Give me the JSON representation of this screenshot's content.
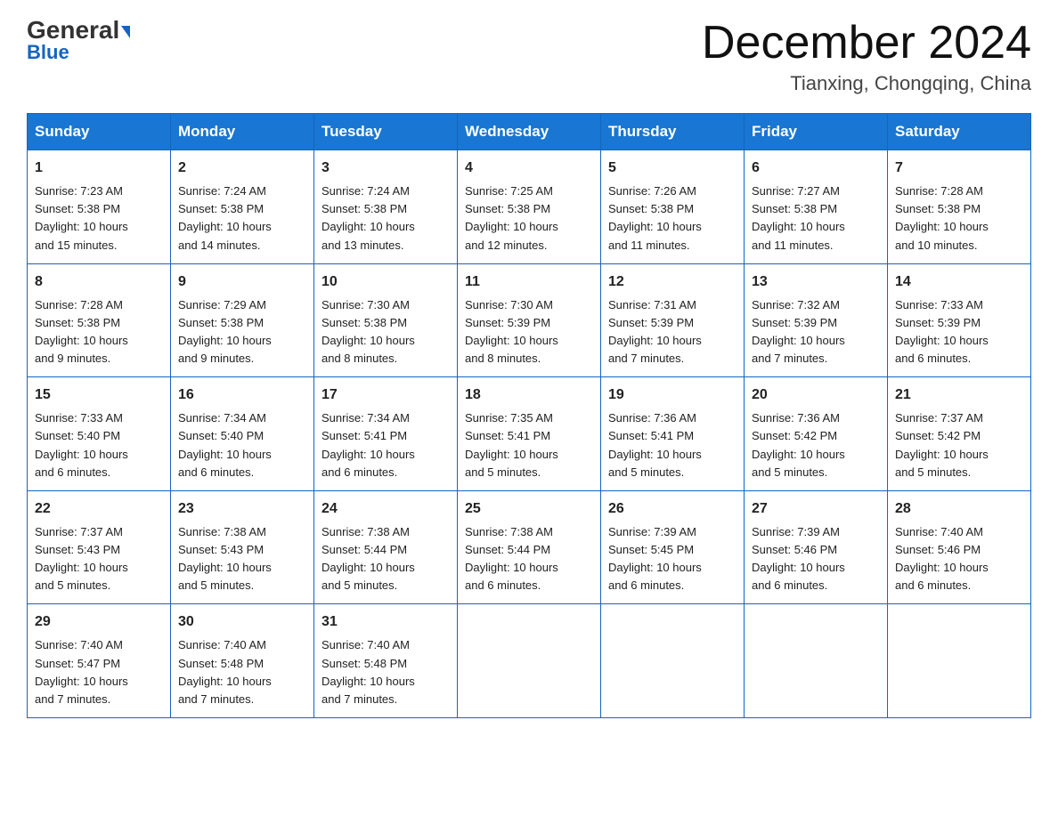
{
  "logo": {
    "general": "General",
    "blue": "Blue",
    "triangle": "▶"
  },
  "header": {
    "month_year": "December 2024",
    "location": "Tianxing, Chongqing, China"
  },
  "days_of_week": [
    "Sunday",
    "Monday",
    "Tuesday",
    "Wednesday",
    "Thursday",
    "Friday",
    "Saturday"
  ],
  "weeks": [
    [
      {
        "day": "1",
        "sunrise": "7:23 AM",
        "sunset": "5:38 PM",
        "daylight": "10 hours and 15 minutes."
      },
      {
        "day": "2",
        "sunrise": "7:24 AM",
        "sunset": "5:38 PM",
        "daylight": "10 hours and 14 minutes."
      },
      {
        "day": "3",
        "sunrise": "7:24 AM",
        "sunset": "5:38 PM",
        "daylight": "10 hours and 13 minutes."
      },
      {
        "day": "4",
        "sunrise": "7:25 AM",
        "sunset": "5:38 PM",
        "daylight": "10 hours and 12 minutes."
      },
      {
        "day": "5",
        "sunrise": "7:26 AM",
        "sunset": "5:38 PM",
        "daylight": "10 hours and 11 minutes."
      },
      {
        "day": "6",
        "sunrise": "7:27 AM",
        "sunset": "5:38 PM",
        "daylight": "10 hours and 11 minutes."
      },
      {
        "day": "7",
        "sunrise": "7:28 AM",
        "sunset": "5:38 PM",
        "daylight": "10 hours and 10 minutes."
      }
    ],
    [
      {
        "day": "8",
        "sunrise": "7:28 AM",
        "sunset": "5:38 PM",
        "daylight": "10 hours and 9 minutes."
      },
      {
        "day": "9",
        "sunrise": "7:29 AM",
        "sunset": "5:38 PM",
        "daylight": "10 hours and 9 minutes."
      },
      {
        "day": "10",
        "sunrise": "7:30 AM",
        "sunset": "5:38 PM",
        "daylight": "10 hours and 8 minutes."
      },
      {
        "day": "11",
        "sunrise": "7:30 AM",
        "sunset": "5:39 PM",
        "daylight": "10 hours and 8 minutes."
      },
      {
        "day": "12",
        "sunrise": "7:31 AM",
        "sunset": "5:39 PM",
        "daylight": "10 hours and 7 minutes."
      },
      {
        "day": "13",
        "sunrise": "7:32 AM",
        "sunset": "5:39 PM",
        "daylight": "10 hours and 7 minutes."
      },
      {
        "day": "14",
        "sunrise": "7:33 AM",
        "sunset": "5:39 PM",
        "daylight": "10 hours and 6 minutes."
      }
    ],
    [
      {
        "day": "15",
        "sunrise": "7:33 AM",
        "sunset": "5:40 PM",
        "daylight": "10 hours and 6 minutes."
      },
      {
        "day": "16",
        "sunrise": "7:34 AM",
        "sunset": "5:40 PM",
        "daylight": "10 hours and 6 minutes."
      },
      {
        "day": "17",
        "sunrise": "7:34 AM",
        "sunset": "5:41 PM",
        "daylight": "10 hours and 6 minutes."
      },
      {
        "day": "18",
        "sunrise": "7:35 AM",
        "sunset": "5:41 PM",
        "daylight": "10 hours and 5 minutes."
      },
      {
        "day": "19",
        "sunrise": "7:36 AM",
        "sunset": "5:41 PM",
        "daylight": "10 hours and 5 minutes."
      },
      {
        "day": "20",
        "sunrise": "7:36 AM",
        "sunset": "5:42 PM",
        "daylight": "10 hours and 5 minutes."
      },
      {
        "day": "21",
        "sunrise": "7:37 AM",
        "sunset": "5:42 PM",
        "daylight": "10 hours and 5 minutes."
      }
    ],
    [
      {
        "day": "22",
        "sunrise": "7:37 AM",
        "sunset": "5:43 PM",
        "daylight": "10 hours and 5 minutes."
      },
      {
        "day": "23",
        "sunrise": "7:38 AM",
        "sunset": "5:43 PM",
        "daylight": "10 hours and 5 minutes."
      },
      {
        "day": "24",
        "sunrise": "7:38 AM",
        "sunset": "5:44 PM",
        "daylight": "10 hours and 5 minutes."
      },
      {
        "day": "25",
        "sunrise": "7:38 AM",
        "sunset": "5:44 PM",
        "daylight": "10 hours and 6 minutes."
      },
      {
        "day": "26",
        "sunrise": "7:39 AM",
        "sunset": "5:45 PM",
        "daylight": "10 hours and 6 minutes."
      },
      {
        "day": "27",
        "sunrise": "7:39 AM",
        "sunset": "5:46 PM",
        "daylight": "10 hours and 6 minutes."
      },
      {
        "day": "28",
        "sunrise": "7:40 AM",
        "sunset": "5:46 PM",
        "daylight": "10 hours and 6 minutes."
      }
    ],
    [
      {
        "day": "29",
        "sunrise": "7:40 AM",
        "sunset": "5:47 PM",
        "daylight": "10 hours and 7 minutes."
      },
      {
        "day": "30",
        "sunrise": "7:40 AM",
        "sunset": "5:48 PM",
        "daylight": "10 hours and 7 minutes."
      },
      {
        "day": "31",
        "sunrise": "7:40 AM",
        "sunset": "5:48 PM",
        "daylight": "10 hours and 7 minutes."
      },
      null,
      null,
      null,
      null
    ]
  ],
  "labels": {
    "sunrise": "Sunrise:",
    "sunset": "Sunset:",
    "daylight": "Daylight:"
  }
}
